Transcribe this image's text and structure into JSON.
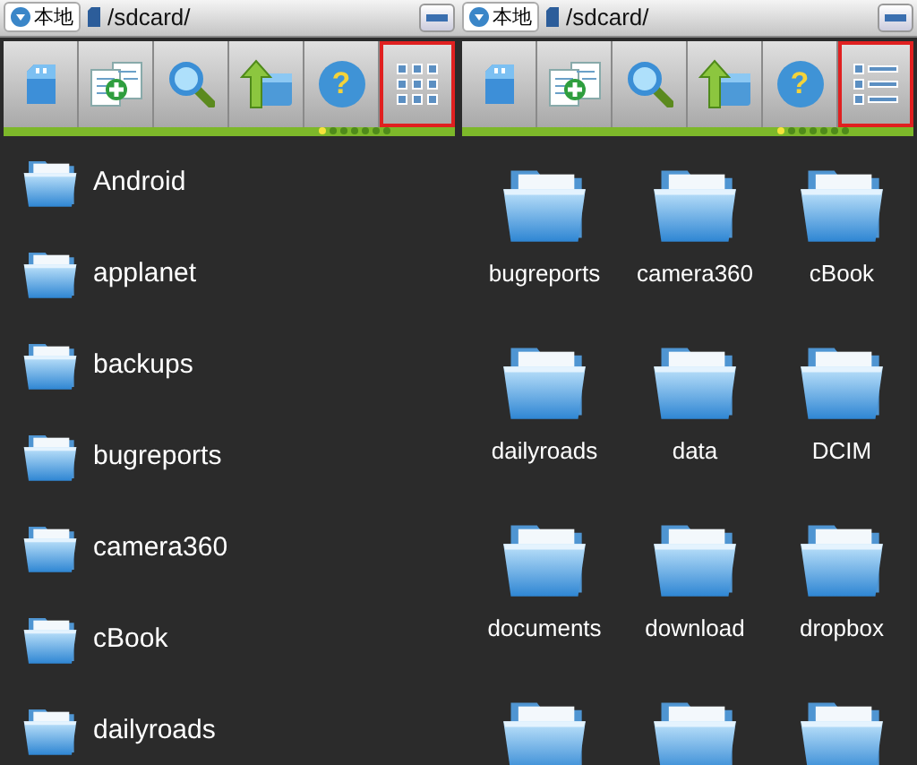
{
  "panels": [
    {
      "location_button": "本地",
      "path": "/sdcard/",
      "kind": "list",
      "tools": [
        {
          "kind": "sdcard",
          "selected": false
        },
        {
          "kind": "add_file",
          "selected": false
        },
        {
          "kind": "search",
          "selected": false
        },
        {
          "kind": "up_folder",
          "selected": false
        },
        {
          "kind": "help",
          "glyph": "?",
          "selected": false
        },
        {
          "kind": "grid_view",
          "selected": true
        }
      ],
      "pager": [
        {
          "selected": true
        },
        {
          "selected": false
        },
        {
          "selected": false
        },
        {
          "selected": false
        },
        {
          "selected": false
        },
        {
          "selected": false
        },
        {
          "selected": false
        }
      ],
      "folders": [
        {
          "label": "Android"
        },
        {
          "label": "applanet"
        },
        {
          "label": "backups"
        },
        {
          "label": "bugreports"
        },
        {
          "label": "camera360"
        },
        {
          "label": "cBook"
        },
        {
          "label": "dailyroads"
        }
      ]
    },
    {
      "location_button": "本地",
      "path": "/sdcard/",
      "kind": "grid",
      "tools": [
        {
          "kind": "sdcard",
          "selected": false
        },
        {
          "kind": "add_file",
          "selected": false
        },
        {
          "kind": "search",
          "selected": false
        },
        {
          "kind": "up_folder",
          "selected": false
        },
        {
          "kind": "help",
          "glyph": "?",
          "selected": false
        },
        {
          "kind": "list_view",
          "selected": true
        }
      ],
      "pager": [
        {
          "selected": true
        },
        {
          "selected": false
        },
        {
          "selected": false
        },
        {
          "selected": false
        },
        {
          "selected": false
        },
        {
          "selected": false
        },
        {
          "selected": false
        }
      ],
      "folders": [
        {
          "label": "bugreports"
        },
        {
          "label": "camera360"
        },
        {
          "label": "cBook"
        },
        {
          "label": "dailyroads"
        },
        {
          "label": "data"
        },
        {
          "label": "DCIM"
        },
        {
          "label": "documents"
        },
        {
          "label": "download"
        },
        {
          "label": "dropbox"
        },
        {
          "kind": "partial"
        },
        {
          "kind": "partial"
        },
        {
          "kind": "partial"
        }
      ]
    }
  ]
}
